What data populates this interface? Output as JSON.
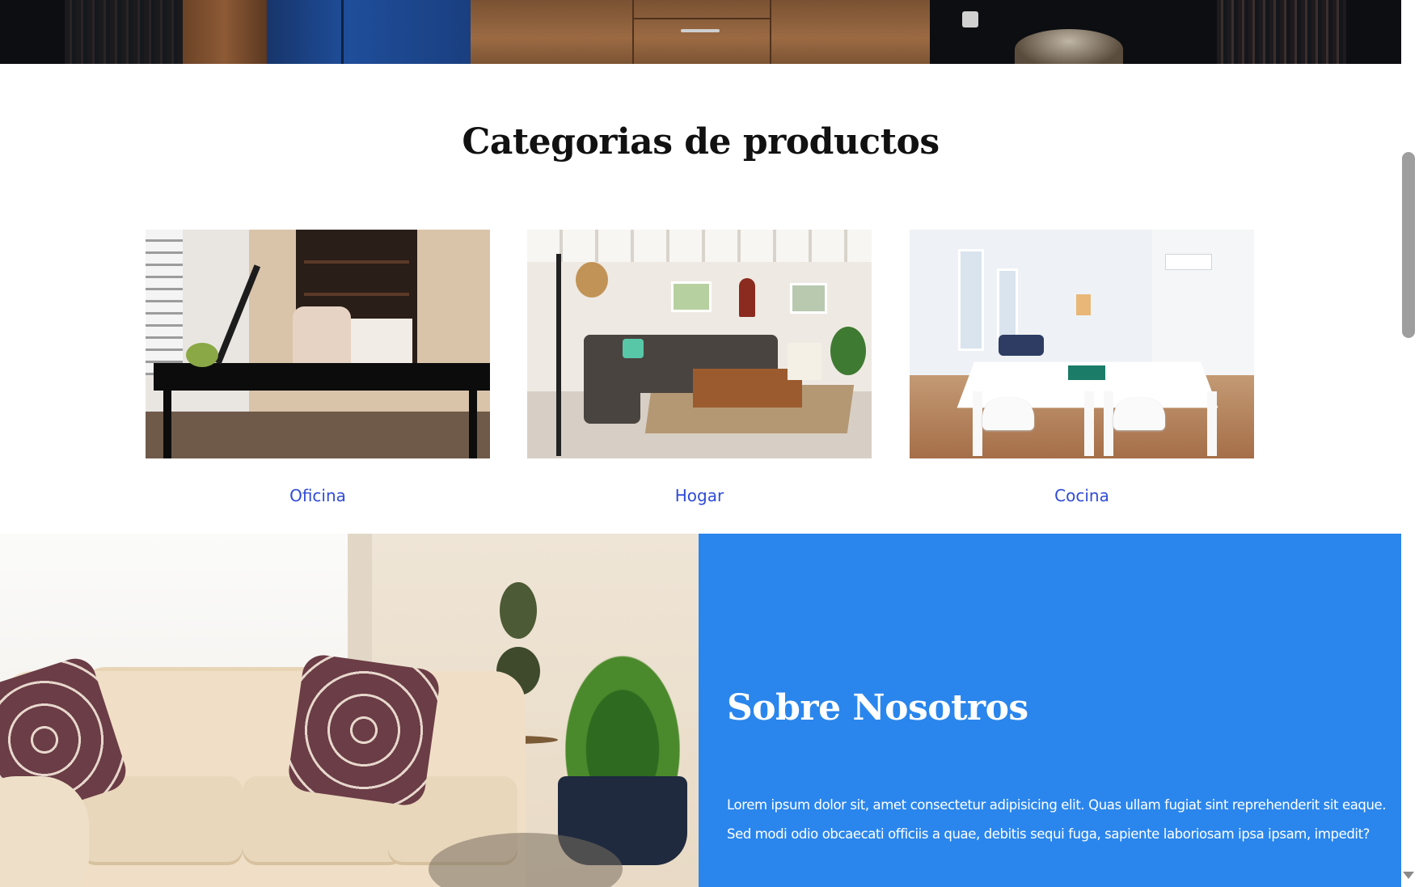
{
  "categories_section": {
    "title": "Categorias de productos",
    "items": [
      {
        "label": "Oficina"
      },
      {
        "label": "Hogar"
      },
      {
        "label": "Cocina"
      }
    ]
  },
  "about": {
    "title": "Sobre Nosotros",
    "text": "Lorem ipsum dolor sit, amet consectetur adipisicing elit. Quas ullam fugiat sint reprehenderit sit eaque. Sed modi odio obcaecati officiis a quae, debitis sequi fuga, sapiente laboriosam ipsa ipsam, impedit?"
  },
  "colors": {
    "accent_blue": "#2a86ec",
    "link_blue": "#2f4bd6",
    "heading": "#111111"
  }
}
